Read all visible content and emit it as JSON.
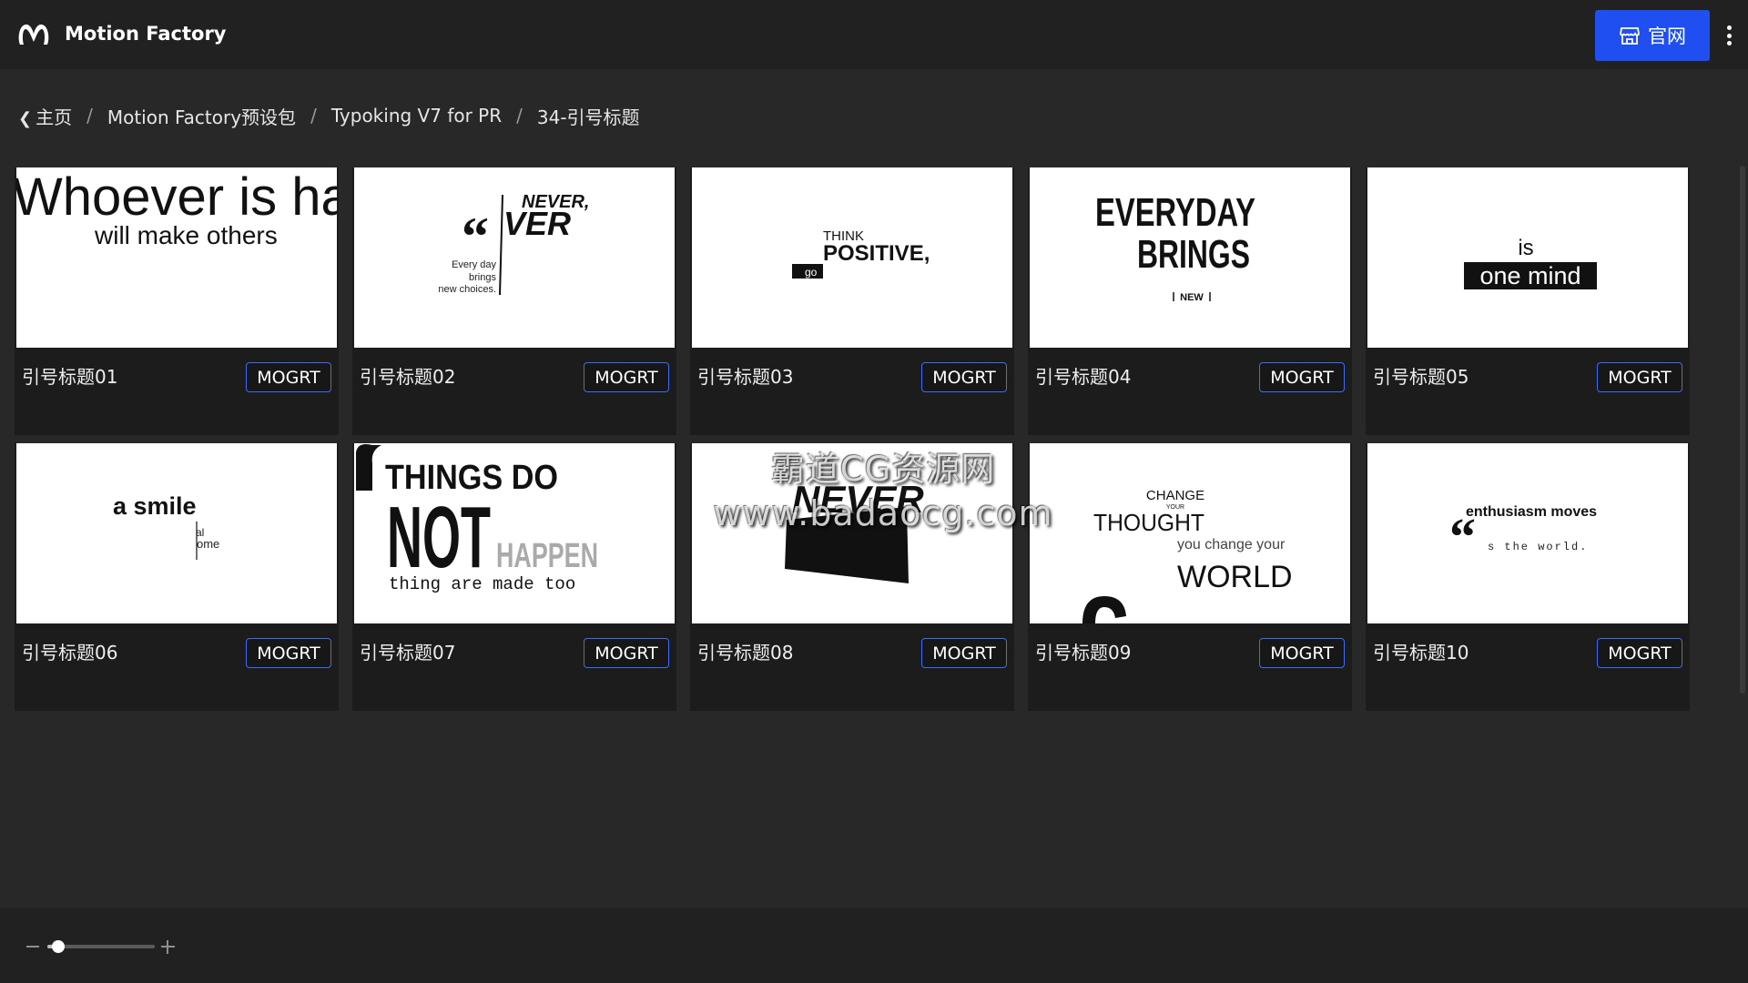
{
  "header": {
    "app_title": "Motion Factory",
    "site_button_label": "官网",
    "icons": {
      "logo": "motion-factory-logo",
      "site": "storefront-icon",
      "more": "more-vertical-icon"
    }
  },
  "breadcrumb": {
    "back_icon": "chevron-left-icon",
    "items": [
      "主页",
      "Motion Factory预设包",
      "Typoking V7 for PR",
      "34-引号标题"
    ],
    "separator": "/"
  },
  "cards": [
    {
      "title": "引号标题01",
      "badge": "MOGRT",
      "thumb": {
        "line1": "Whoever is ha",
        "line2": "will make others"
      }
    },
    {
      "title": "引号标题02",
      "badge": "MOGRT",
      "thumb": {
        "line1": "NEVER,",
        "line2": "VER",
        "line3": "Every day",
        "line4": "brings",
        "line5": "new choices."
      }
    },
    {
      "title": "引号标题03",
      "badge": "MOGRT",
      "thumb": {
        "line1": "THINK",
        "line2": "POSITIVE,",
        "line3": "go"
      }
    },
    {
      "title": "引号标题04",
      "badge": "MOGRT",
      "thumb": {
        "line1": "EVERYDAY",
        "line2": "BRINGS",
        "line3": "NEW"
      }
    },
    {
      "title": "引号标题05",
      "badge": "MOGRT",
      "thumb": {
        "line1": "is",
        "line2": "one mind"
      }
    },
    {
      "title": "引号标题06",
      "badge": "MOGRT",
      "thumb": {
        "line1": "a smile",
        "line2": "al",
        "line3": "ome"
      }
    },
    {
      "title": "引号标题07",
      "badge": "MOGRT",
      "thumb": {
        "line1": "THINGS DO",
        "line2": "NOT",
        "line3": "HAPPEN",
        "line4": "thing are made too"
      }
    },
    {
      "title": "引号标题08",
      "badge": "MOGRT",
      "thumb": {
        "line1": "NEVER"
      }
    },
    {
      "title": "引号标题09",
      "badge": "MOGRT",
      "thumb": {
        "line1": "CHANGE",
        "line2": "YOUR",
        "line3": "THOUGHT",
        "line4": "you change your",
        "line5": "WORLD"
      }
    },
    {
      "title": "引号标题10",
      "badge": "MOGRT",
      "thumb": {
        "line1": "enthusiasm moves",
        "line2": "s the world."
      }
    }
  ],
  "watermark": {
    "line1": "霸道CG资源网",
    "line2": "www.badaocg.com"
  },
  "zoom": {
    "value_fraction": 0.1
  },
  "colors": {
    "accent": "#1f4ff0",
    "badge_border": "#3d6df5",
    "background": "#282828"
  }
}
